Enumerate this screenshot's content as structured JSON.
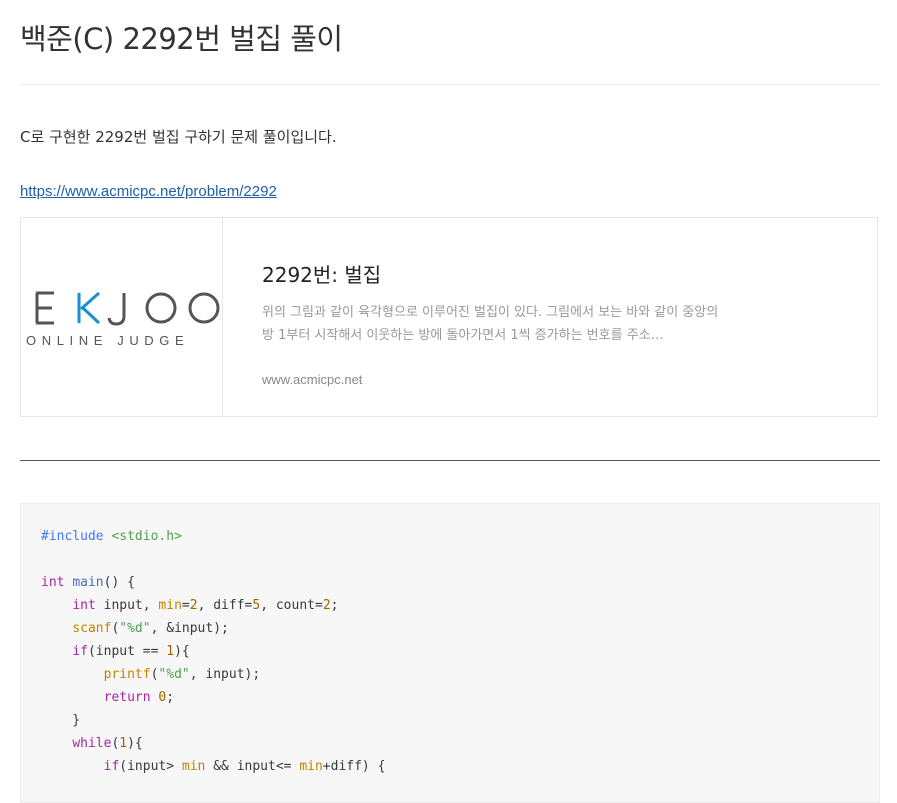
{
  "post": {
    "title": "백준(C) 2292번 벌집 풀이",
    "intro": "C로 구현한 2292번 벌집 구하기 문제 풀이입니다.",
    "link": "https://www.acmicpc.net/problem/2292"
  },
  "link_card": {
    "logo_text": "BAEKJOON",
    "logo_visible": "EKJOO",
    "logo_sub": "ONLINE JUDGE",
    "title": "2292번: 벌집",
    "description": "위의 그림과 같이 육각형으로 이루어진 벌집이 있다. 그림에서 보는 바와 같이 중앙의 방 1부터 시작해서 이웃하는 방에 돌아가면서 1씩 증가하는 번호를 주소…",
    "domain": "www.acmicpc.net"
  },
  "code": {
    "lines": [
      [
        [
          "pre",
          "#include "
        ],
        [
          "str",
          "<stdio.h>"
        ]
      ],
      [],
      [
        [
          "type",
          "int"
        ],
        [
          "plain",
          " "
        ],
        [
          "fn2",
          "main"
        ],
        [
          "plain",
          "() {"
        ]
      ],
      [
        [
          "plain",
          "    "
        ],
        [
          "type",
          "int"
        ],
        [
          "plain",
          " input, "
        ],
        [
          "fn",
          "min"
        ],
        [
          "plain",
          "="
        ],
        [
          "num",
          "2"
        ],
        [
          "plain",
          ", diff="
        ],
        [
          "num",
          "5"
        ],
        [
          "plain",
          ", count="
        ],
        [
          "num",
          "2"
        ],
        [
          "plain",
          ";"
        ]
      ],
      [
        [
          "plain",
          "    "
        ],
        [
          "fn",
          "scanf"
        ],
        [
          "plain",
          "("
        ],
        [
          "str",
          "\"%d\""
        ],
        [
          "plain",
          ", &input);"
        ]
      ],
      [
        [
          "plain",
          "    "
        ],
        [
          "kw",
          "if"
        ],
        [
          "plain",
          "(input == "
        ],
        [
          "num",
          "1"
        ],
        [
          "plain",
          "){"
        ]
      ],
      [
        [
          "plain",
          "        "
        ],
        [
          "fn",
          "printf"
        ],
        [
          "plain",
          "("
        ],
        [
          "str",
          "\"%d\""
        ],
        [
          "plain",
          ", input);"
        ]
      ],
      [
        [
          "plain",
          "        "
        ],
        [
          "kw",
          "return"
        ],
        [
          "plain",
          " "
        ],
        [
          "num",
          "0"
        ],
        [
          "plain",
          ";"
        ]
      ],
      [
        [
          "plain",
          "    }"
        ]
      ],
      [
        [
          "plain",
          "    "
        ],
        [
          "kw",
          "while"
        ],
        [
          "plain",
          "("
        ],
        [
          "num",
          "1"
        ],
        [
          "plain",
          "){"
        ]
      ],
      [
        [
          "plain",
          "        "
        ],
        [
          "kw",
          "if"
        ],
        [
          "plain",
          "(input> "
        ],
        [
          "fn",
          "min"
        ],
        [
          "plain",
          " && input<= "
        ],
        [
          "fn",
          "min"
        ],
        [
          "plain",
          "+diff) {"
        ]
      ]
    ]
  }
}
